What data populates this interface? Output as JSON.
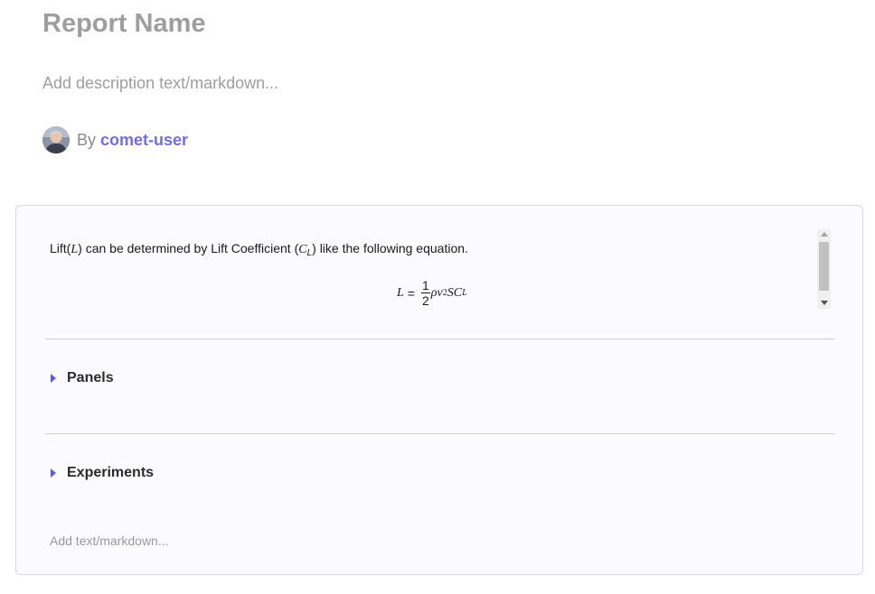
{
  "report": {
    "title": "Report Name",
    "description_placeholder": "Add description text/markdown...",
    "author_prefix": "By",
    "author_name": "comet-user"
  },
  "markdown_block": {
    "text_before": "Lift(",
    "var_L": "L",
    "text_middle": ") can be determined by Lift Coefficient (",
    "var_C": "C",
    "sub_L": "L",
    "text_after": ") like the following equation.",
    "equation": {
      "lhs": "L",
      "equals": "=",
      "frac_num": "1",
      "frac_den": "2",
      "rho": "ρ",
      "v": "v",
      "exp": "2",
      "S": "S",
      "C": "C",
      "C_sub": "L"
    }
  },
  "sections": [
    {
      "label": "Panels"
    },
    {
      "label": "Experiments"
    }
  ],
  "footer": {
    "add_text_placeholder": "Add text/markdown..."
  },
  "colors": {
    "accent": "#6f6ee6",
    "caret": "#5b5bd6",
    "muted_text": "#9e9e9e"
  }
}
